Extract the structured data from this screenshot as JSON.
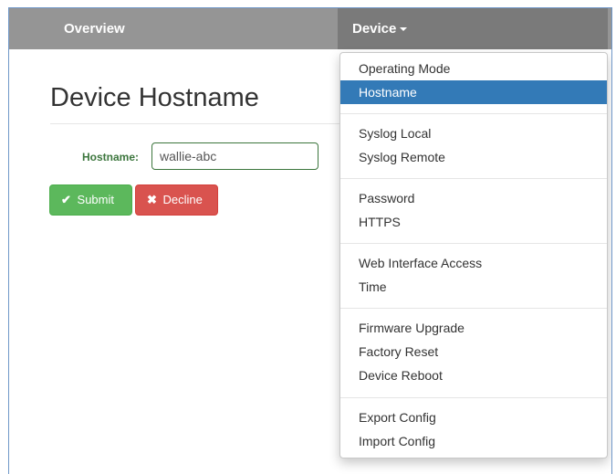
{
  "navbar": {
    "overview_label": "Overview",
    "device_label": "Device"
  },
  "page": {
    "title": "Device Hostname"
  },
  "form": {
    "hostname_label": "Hostname:",
    "hostname_value": "wallie-abc",
    "submit_icon": "✔",
    "submit_label": "Submit",
    "decline_icon": "✖",
    "decline_label": "Decline"
  },
  "dropdown": {
    "items": [
      {
        "label": "Operating Mode"
      },
      {
        "label": "Hostname",
        "active": true
      },
      {
        "label": "Syslog Local"
      },
      {
        "label": "Syslog Remote"
      },
      {
        "label": "Password"
      },
      {
        "label": "HTTPS"
      },
      {
        "label": "Web Interface Access"
      },
      {
        "label": "Time"
      },
      {
        "label": "Firmware Upgrade"
      },
      {
        "label": "Factory Reset"
      },
      {
        "label": "Device Reboot"
      },
      {
        "label": "Export Config"
      },
      {
        "label": "Import Config"
      }
    ]
  },
  "colors": {
    "navbar": "#959595",
    "navbar_active": "#7a7a7a",
    "menu_active": "#337ab7",
    "success": "#5cb85c",
    "danger": "#d9534f",
    "label_green": "#3c763d"
  }
}
